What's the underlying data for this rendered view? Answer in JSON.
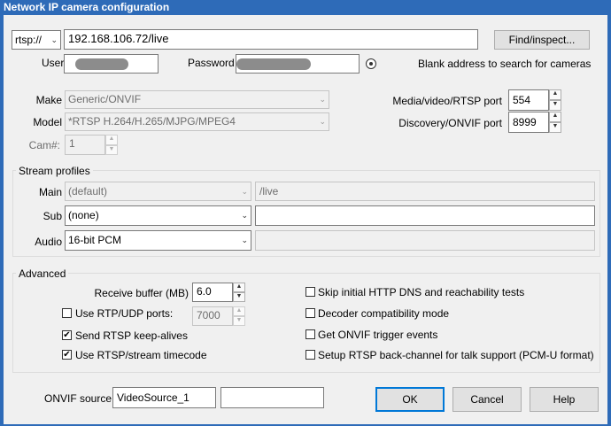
{
  "window": {
    "title": "Network IP camera configuration"
  },
  "address": {
    "scheme": "rtsp://",
    "url": "192.168.106.72/live",
    "find_button": "Find/inspect...",
    "user_label": "User",
    "password_label": "Password",
    "hint": "Blank address to search for cameras"
  },
  "device": {
    "make_label": "Make",
    "make_value": "Generic/ONVIF",
    "model_label": "Model",
    "model_value": "*RTSP H.264/H.265/MJPG/MPEG4",
    "cam_label": "Cam#:",
    "cam_value": "1",
    "rtsp_port_label": "Media/video/RTSP port",
    "rtsp_port_value": "554",
    "onvif_port_label": "Discovery/ONVIF port",
    "onvif_port_value": "8999"
  },
  "stream_profiles": {
    "title": "Stream profiles",
    "main_label": "Main",
    "main_value": "(default)",
    "main_path": "/live",
    "sub_label": "Sub",
    "sub_value": "(none)",
    "sub_path": "",
    "audio_label": "Audio",
    "audio_value": "16-bit PCM",
    "audio_extra": ""
  },
  "advanced": {
    "title": "Advanced",
    "receive_buffer_label": "Receive buffer (MB)",
    "receive_buffer_value": "6.0",
    "rtp_udp_label": "Use RTP/UDP ports:",
    "rtp_udp_checked": false,
    "rtp_udp_port": "7000",
    "keepalive_label": "Send RTSP keep-alives",
    "keepalive_checked": true,
    "timecode_label": "Use RTSP/stream timecode",
    "timecode_checked": true,
    "skip_http_label": "Skip initial HTTP DNS and reachability tests",
    "skip_http_checked": false,
    "decoder_compat_label": "Decoder compatibility mode",
    "decoder_compat_checked": false,
    "onvif_events_label": "Get ONVIF trigger events",
    "onvif_events_checked": false,
    "backchannel_label": "Setup RTSP back-channel for talk support (PCM-U format)",
    "backchannel_checked": false
  },
  "footer": {
    "onvif_source_label": "ONVIF source:",
    "onvif_source_value": "VideoSource_1",
    "onvif_source_extra": "",
    "ok": "OK",
    "cancel": "Cancel",
    "help": "Help"
  },
  "icons": {
    "check": "check-icon",
    "chevron": "chevron-down-icon",
    "spin_up": "spin-up-icon",
    "spin_down": "spin-down-icon",
    "eye": "eye-icon"
  },
  "colors": {
    "titlebar": "#2e6bb8",
    "default_button_border": "#0078d7",
    "masked_field": "#8c8c8c"
  }
}
